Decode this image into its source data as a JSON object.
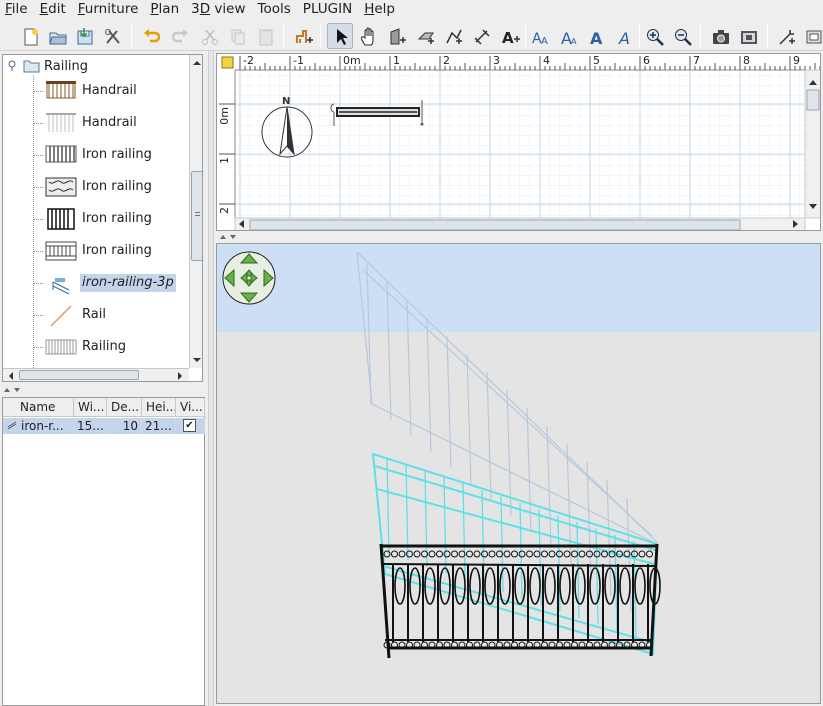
{
  "menu": [
    "File",
    "Edit",
    "Furniture",
    "Plan",
    "3D view",
    "Tools",
    "PLUGIN",
    "Help"
  ],
  "menu_mnemonic_index": [
    0,
    0,
    0,
    0,
    1,
    -1,
    -1,
    0
  ],
  "toolbar_icons": [
    "new-home-icon",
    "open-icon",
    "save-icon",
    "preferences-icon",
    "undo-icon",
    "redo-icon",
    "cut-icon",
    "copy-icon",
    "paste-icon",
    "add-furniture-icon",
    "select-mode-icon",
    "pan-mode-icon",
    "create-walls-icon",
    "create-rooms-icon",
    "create-polylines-icon",
    "create-dimensions-icon",
    "add-text-icon",
    "increase-text-size-icon",
    "decrease-text-size-icon",
    "bold-text-icon",
    "italic-text-icon",
    "zoom-in-icon",
    "zoom-out-icon",
    "create-photo-icon",
    "create-video-icon",
    "plugin-icon",
    "more-icon"
  ],
  "catalog": {
    "category": "Railing",
    "items": [
      "Handrail",
      "Handrail",
      "Iron railing",
      "Iron railing",
      "Iron railing",
      "Iron railing",
      "iron-railing-3p",
      "Rail",
      "Railing"
    ],
    "selected_index": 6
  },
  "furniture_table": {
    "columns": [
      "Name",
      "Wi...",
      "De...",
      "Hei...",
      "Vi..."
    ],
    "rows": [
      {
        "name": "iron-r...",
        "width": "15...",
        "depth": "10",
        "height": "21...",
        "visible": "✔"
      }
    ]
  },
  "plan": {
    "ruler_x": [
      "-2",
      "-1",
      "0m",
      "1",
      "2",
      "3",
      "4",
      "5",
      "6",
      "7",
      "8",
      "9"
    ],
    "ruler_y": [
      "0m",
      "1",
      "2"
    ],
    "compass_label": "N"
  },
  "view3d": {
    "sky_color": "#cddff5",
    "ground_color": "#e4e4e4",
    "navigator_color": "#6ab04c"
  },
  "colors": {
    "selection": "#c4d4ea",
    "plan_grid": "#dbe6f0",
    "railing_selected": "#5fe0e8"
  }
}
